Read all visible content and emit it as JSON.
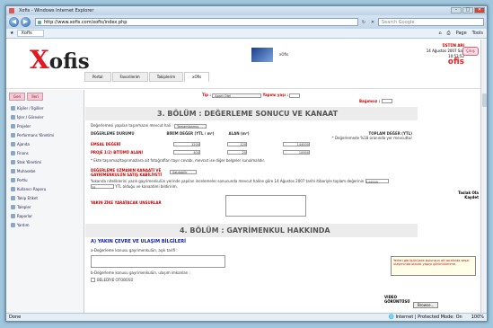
{
  "window": {
    "title": "Xofis - Windows Internet Explorer"
  },
  "browser": {
    "url": "http://www.xofis.com/xofis/index.php",
    "search_placeholder": "Search Google",
    "tab": "Xofis",
    "page_menu": "Page",
    "tools_menu": "Tools",
    "status_left": "Done",
    "status_zone": "Internet | Protected Mode: On",
    "zoom": "100%"
  },
  "app": {
    "logo": "ofis",
    "logo_x": "X",
    "banner": "xOfis",
    "user_name": "ÜSTÜN ARI",
    "user_date": "14 Ağustos 2007 Salı",
    "user_time": "10:53:52",
    "logout": "Çıkış",
    "right_label1": "Taslak Ola",
    "right_label2": "Kaydet",
    "nav": [
      "Portal",
      "Favorilerim",
      "Takiplerim",
      "xOfis"
    ],
    "pager": [
      "Geri",
      "İleri"
    ],
    "sidebar": [
      "Kişiler / İlgililer",
      "İşler / Görevler",
      "Projeler",
      "Performans Yönetimi",
      "Ajanda",
      "Finans",
      "Stok Yönetimi",
      "Muhasebe",
      "Portlu",
      "Kullanıcı Raporu",
      "Takip Etiket",
      "Talepler",
      "Raporlar",
      "Yardım"
    ]
  },
  "form": {
    "tip_label": "Tip :",
    "tip_value": "Apart Otel",
    "yapim_label": "Yapımı yaşı :",
    "bagimsiz_label": "Bağımsız :",
    "section3": "3. BÖLÜM : DEĞERLEME SONUCU VE KANAAT",
    "usage_label": "Değerlemesi yapılan taşınmazın mevcut hali :",
    "usage_value": "Tamamlanmış",
    "col1": "DEĞERLEME DURUMU",
    "col2": "BİRİM DEĞER (YTL / m²)",
    "col3": "ALAN (m²)",
    "col4": "TOPLAM DEĞER (YTL)",
    "kdv_note": "* Değerlemede %18 oranında yer mevcuttur",
    "row1": "EMSAL DEĞERİ",
    "row1_v1": "1200",
    "row1_v2": "120",
    "row1_v3": "144000",
    "row2": "PROJE 1/2) BİTÜMÜ ALANI",
    "row2_v1": "400",
    "row2_v2": "25",
    "row2_v3": "10000",
    "note": "* Ekte taşınmaz/taşınmazlara ait fotoğrafları tayır cevabı, mevcut ise diğer belgeler sunulmalıdır.",
    "opinion_label": "DEĞERLEME UZMANIN KANAATİ VE GAYRİMENKULÜN SATIŞ KABİLİYETİ",
    "opinion_value": "Satılabilir",
    "opinion_text": "Yukarıda niteliklerini yazılı gayrimenkulün yerinde yapılan incelemeler sonucunda mevcut haline göre 14 Ağustos 2007 tarihi itibariyle toplam değerinin",
    "opinion_v1": "144000",
    "opinion_v2": "35",
    "opinion_text2": "YTL olduğu ve kanaatimi bildiririm.",
    "market_label": "YAKIN ZİKE YARATACAK UNSURLAR",
    "tooltip": "Yerleri görüşünüzde bulunsun alt tarafında sesal ulaşımında olacak yapıyı görüntülenme.",
    "section4": "4. BÖLÜM : GAYRİMENKUL HAKKINDA",
    "sub4": "A) YAKIN ÇEVRE VE ULAŞIM BİLGİLERİ",
    "sub4a": "a-Değerleme konusu gayrimenkulün, açık tarifi :",
    "foto_label": "VIDEO GÖRÜNTÜSÜ",
    "browse": "Browse...",
    "sub4b": "b-Değerleme konusu gayrimenkulün, ulaşım imkanları :",
    "bus": "BELEDİYE OTOBÜSÜ"
  }
}
